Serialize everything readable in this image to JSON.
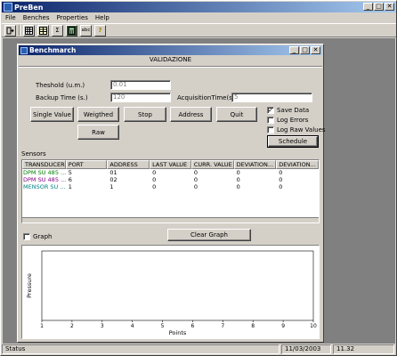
{
  "app": {
    "title": "PreBen"
  },
  "window_buttons": {
    "minimize": "_",
    "maximize": "□",
    "close": "✕"
  },
  "menu": [
    "File",
    "Benches",
    "Properties",
    "Help"
  ],
  "toolbar": {
    "sigma": "Σ",
    "abc": "abc",
    "help": "?"
  },
  "child": {
    "title": "Benchmarch",
    "heading": "VALIDAZIONE"
  },
  "form": {
    "threshold_label": "Theshold (u.m.)",
    "threshold_value": "0.01",
    "backup_label": "Backup Time (s.)",
    "backup_value": "120",
    "acq_label": "AcquisitionTime(s.)",
    "acq_value": "5"
  },
  "buttons": {
    "single_value": "Single Value",
    "weighted": "Weigthed",
    "stop": "Stop",
    "address": "Address",
    "quit": "Quit",
    "raw": "Raw",
    "schedule": "Schedule",
    "clear_graph": "Clear Graph"
  },
  "options": {
    "save_data": "Save Data",
    "save_data_checked": "✓",
    "log_errors": "Log Errors",
    "log_raw": "Log Raw Values"
  },
  "sensors": {
    "title": "Sensors",
    "columns": [
      "TRANSDUCER",
      "PORT",
      "ADDRESS",
      "LAST VALUE",
      "CURR. VALUE",
      "DEVIATION...",
      "DEVIATION..."
    ],
    "rows": [
      {
        "cells": [
          "DPM SU 485 ...",
          "5",
          "01",
          "0",
          "0",
          "0",
          "0"
        ],
        "color": "#008000"
      },
      {
        "cells": [
          "DPM SU 485 ...",
          "6",
          "02",
          "0",
          "0",
          "0",
          "0"
        ],
        "color": "#800080"
      },
      {
        "cells": [
          "MENSOR SU ...",
          "1",
          "1",
          "0",
          "0",
          "0",
          "0"
        ],
        "color": "#008080"
      }
    ]
  },
  "graph": {
    "checkbox_label": "Graph"
  },
  "chart_data": {
    "type": "line",
    "xlabel": "Points",
    "ylabel": "Pressure",
    "xlim": [
      1,
      10
    ],
    "xticks": [
      "1",
      "2",
      "3",
      "4",
      "5",
      "6",
      "7",
      "8",
      "9",
      "10"
    ],
    "series": []
  },
  "status": {
    "text": "Status",
    "date": "11/03/2003",
    "time": "11.32"
  }
}
